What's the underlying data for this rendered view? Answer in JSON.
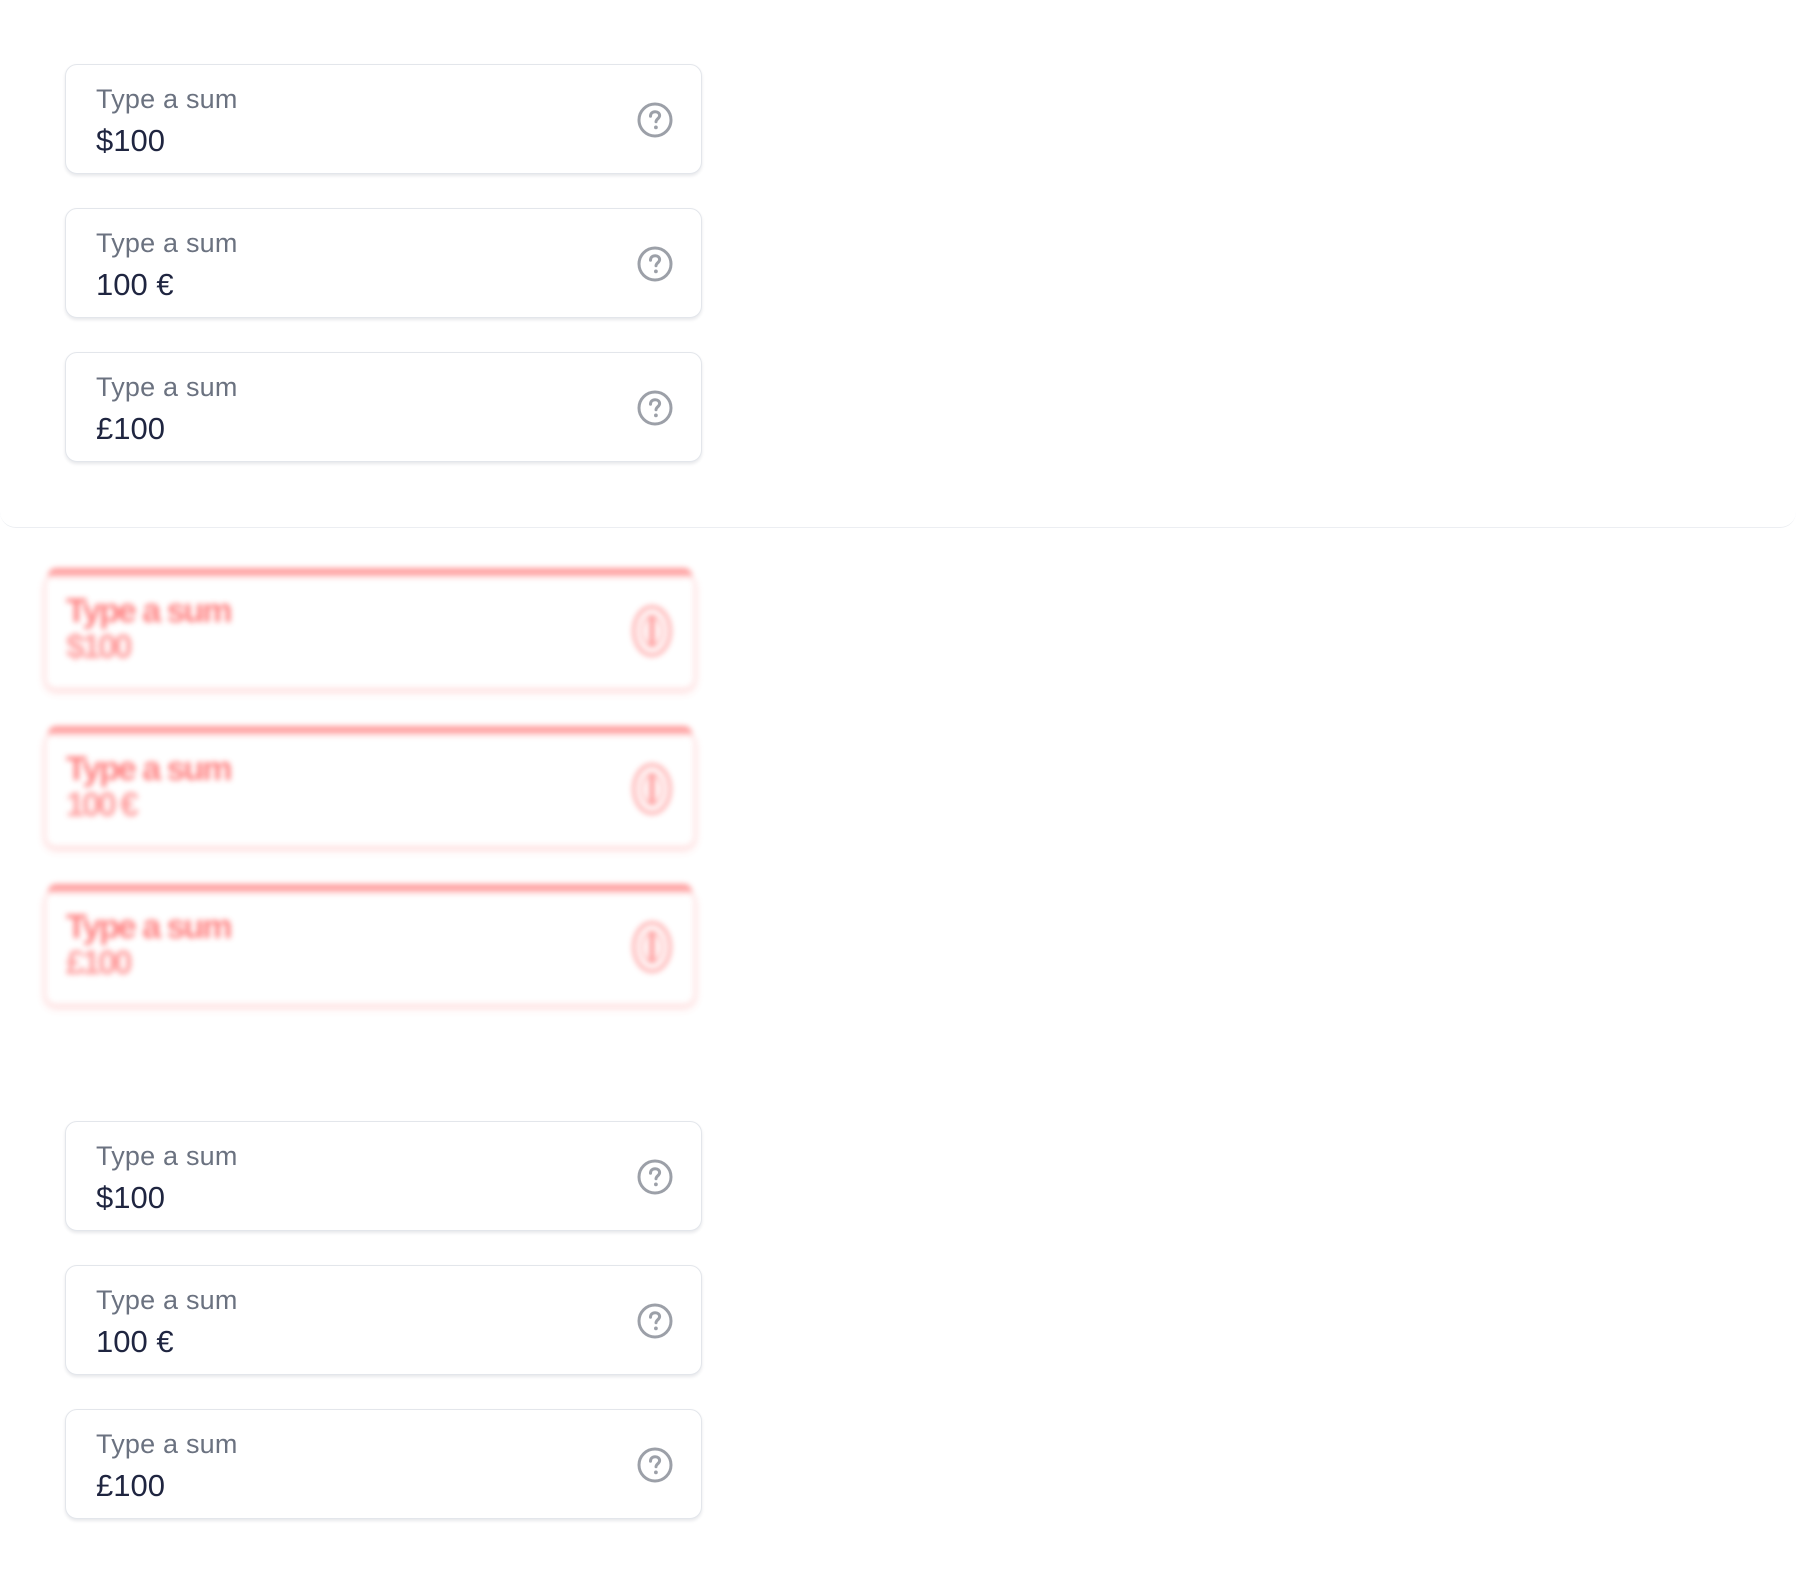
{
  "top_group": {
    "fields": [
      {
        "label": "Type a sum",
        "value": "$100",
        "icon": "help-circle-icon"
      },
      {
        "label": "Type a sum",
        "value": "100 €",
        "icon": "help-circle-icon"
      },
      {
        "label": "Type a sum",
        "value": "£100",
        "icon": "help-circle-icon"
      }
    ]
  },
  "ghost_group": {
    "fields": [
      {
        "label": "Type a sum",
        "value": "$100",
        "icon": "help-circle-icon"
      },
      {
        "label": "Type a sum",
        "value": "100 €",
        "icon": "help-circle-icon"
      },
      {
        "label": "Type a sum",
        "value": "£100",
        "icon": "help-circle-icon"
      }
    ]
  },
  "bottom_group": {
    "fields": [
      {
        "label": "Type a sum",
        "value": "$100",
        "icon": "help-circle-icon"
      },
      {
        "label": "Type a sum",
        "value": "100 €",
        "icon": "help-circle-icon"
      },
      {
        "label": "Type a sum",
        "value": "£100",
        "icon": "help-circle-icon"
      }
    ]
  },
  "colors": {
    "label": "#6b7280",
    "value": "#1f2540",
    "border": "#e3e6eb",
    "icon": "#9ca0a8",
    "ghost_accent": "#ff8a8a"
  }
}
